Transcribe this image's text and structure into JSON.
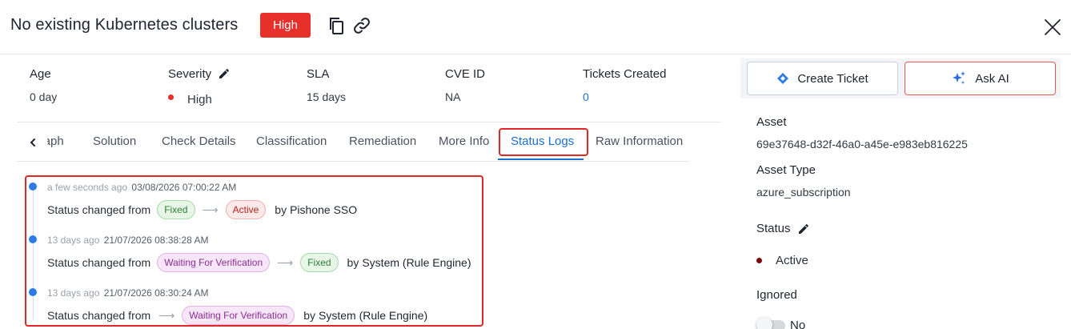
{
  "header": {
    "title": "No existing Kubernetes clusters",
    "severity_badge": "High",
    "icons": [
      "copy-icon",
      "link-icon",
      "close-icon"
    ]
  },
  "info": {
    "age": {
      "label": "Age",
      "value": "0 day"
    },
    "severity": {
      "label": "Severity",
      "value": "High"
    },
    "sla": {
      "label": "SLA",
      "value": "15 days"
    },
    "cve": {
      "label": "CVE ID",
      "value": "NA"
    },
    "tickets": {
      "label": "Tickets Created",
      "value": "0"
    }
  },
  "tabs": [
    {
      "label": "Graph"
    },
    {
      "label": "Solution"
    },
    {
      "label": "Check Details"
    },
    {
      "label": "Classification"
    },
    {
      "label": "Remediation"
    },
    {
      "label": "More Info"
    },
    {
      "label": "Status Logs"
    },
    {
      "label": "Raw Information"
    }
  ],
  "active_tab": "Status Logs",
  "logs": [
    {
      "relative": "a few seconds ago",
      "timestamp": "03/08/2026 07:00:22 AM",
      "prefix": "Status changed from",
      "from": "Fixed",
      "to": "Active",
      "by": "by",
      "actor": "Pishone SSO"
    },
    {
      "relative": "13 days ago",
      "timestamp": "21/07/2026 08:38:28 AM",
      "prefix": "Status changed from",
      "from": "Waiting For Verification",
      "to": "Fixed",
      "by": "by",
      "actor": "System (Rule Engine)"
    },
    {
      "relative": "13 days ago",
      "timestamp": "21/07/2026 08:30:24 AM",
      "prefix": "Status changed from",
      "from": "",
      "to": "Waiting For Verification",
      "by": "by",
      "actor": "System (Rule Engine)"
    }
  ],
  "actions": {
    "create_ticket": "Create Ticket",
    "ask_ai": "Ask AI"
  },
  "details": {
    "asset_label": "Asset",
    "asset_value": "69e37648-d32f-46a0-a45e-e983eb816225",
    "asset_type_label": "Asset Type",
    "asset_type_value": "azure_subscription",
    "status_label": "Status",
    "status_value": "Active",
    "ignored_label": "Ignored",
    "ignored_value": "No"
  },
  "colors": {
    "severity_high": "#e8302a",
    "accent_blue": "#1b6fd3",
    "highlight_red": "#e02626",
    "timeline_dot": "#2f7be6"
  }
}
